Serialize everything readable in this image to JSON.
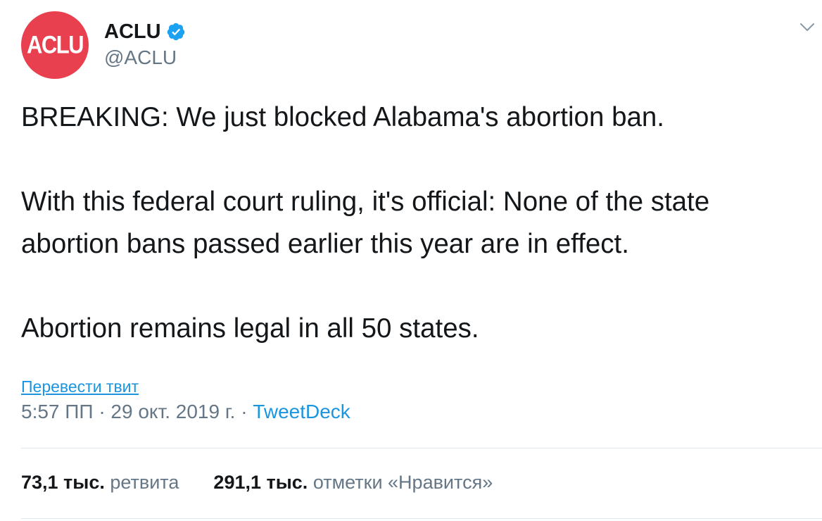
{
  "author": {
    "avatar_text": "ACLU",
    "name": "ACLU",
    "handle": "@ACLU",
    "verified": true
  },
  "tweet": {
    "paragraphs": [
      "BREAKING: We just blocked Alabama's abortion ban.",
      "With this federal court ruling, it's official: None of the state abortion bans passed earlier this year are in effect.",
      "Abortion remains legal in all 50 states."
    ]
  },
  "translate_link": "Перевести твит",
  "meta": {
    "time": "5:57 ПП",
    "separator": "·",
    "date": "29 окт. 2019 г.",
    "source": "TweetDeck"
  },
  "stats": {
    "retweets_count": "73,1 тыс.",
    "retweets_label": "ретвита",
    "likes_count": "291,1 тыс.",
    "likes_label": "отметки «Нравится»"
  },
  "icons": {
    "verified": "verified-badge-icon",
    "menu": "chevron-down-icon"
  },
  "colors": {
    "avatar": "#e8404e",
    "verified": "#1da1f2",
    "link": "#1b95e0",
    "secondary_text": "#657786",
    "divider": "#e1e8ed"
  }
}
